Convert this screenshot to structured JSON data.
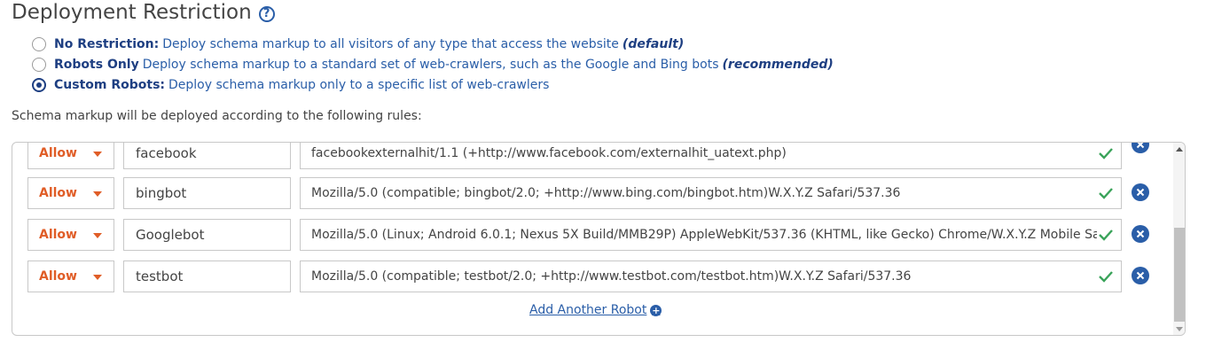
{
  "section": {
    "title": "Deployment Restriction"
  },
  "options": [
    {
      "name": "No Restriction:",
      "description": "Deploy schema markup to all visitors of any type that access the website",
      "note": "(default)",
      "selected": false
    },
    {
      "name": "Robots Only",
      "description": "Deploy schema markup to a standard set of web-crawlers, such as the Google and Bing bots",
      "note": "(recommended)",
      "selected": false
    },
    {
      "name": "Custom Robots:",
      "description": "Deploy schema markup only to a specific list of web-crawlers",
      "note": "",
      "selected": true
    }
  ],
  "rules_text": "Schema markup will be deployed according to the following rules:",
  "rules": [
    {
      "action": "Allow",
      "robot": "facebook",
      "user_agent": "facebookexternalhit/1.1 (+http://www.facebook.com/externalhit_uatext.php)"
    },
    {
      "action": "Allow",
      "robot": "bingbot",
      "user_agent": "Mozilla/5.0 (compatible; bingbot/2.0; +http://www.bing.com/bingbot.htm)W.X.Y.Z Safari/537.36"
    },
    {
      "action": "Allow",
      "robot": "Googlebot",
      "user_agent": "Mozilla/5.0 (Linux; Android 6.0.1; Nexus 5X Build/MMB29P) AppleWebKit/537.36 (KHTML, like Gecko) Chrome/W.X.Y.Z Mobile Safari/"
    },
    {
      "action": "Allow",
      "robot": "testbot",
      "user_agent": "Mozilla/5.0 (compatible; testbot/2.0; +http://www.testbot.com/testbot.htm)W.X.Y.Z Safari/537.36"
    }
  ],
  "add_link": "Add Another Robot",
  "colors": {
    "accent": "#2a5ea8",
    "allow": "#e05d27",
    "valid": "#3aa35a"
  },
  "icons": {
    "help": "help-circle-icon",
    "valid": "checkmark-icon",
    "delete": "close-circle-icon",
    "add": "plus-circle-icon"
  }
}
